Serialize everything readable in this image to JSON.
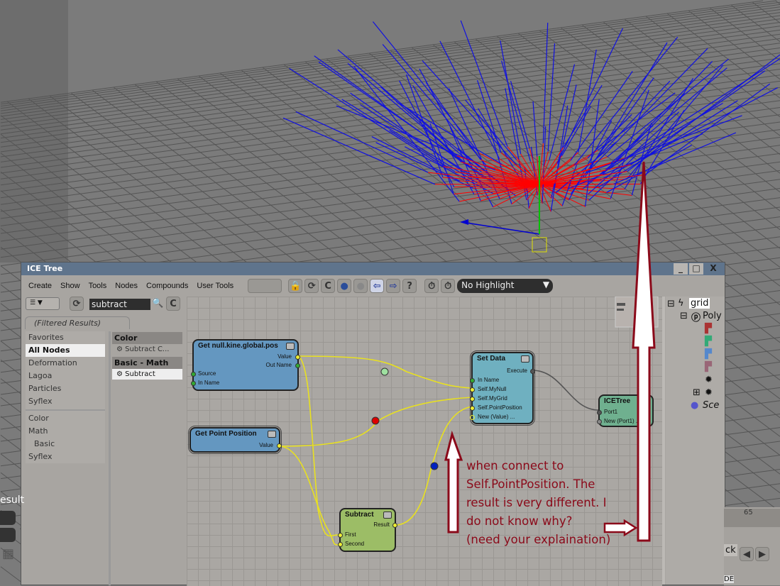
{
  "window": {
    "title": "ICE Tree",
    "minimize": "_",
    "maximize": "□",
    "close": "X"
  },
  "menu": [
    "Create",
    "Show",
    "Tools",
    "Nodes",
    "Compounds",
    "User Tools"
  ],
  "toolbar": {
    "highlight_select": "No Highlight",
    "help": "?"
  },
  "search": {
    "value": "subtract"
  },
  "filter_tab": "(Filtered Results)",
  "categories": [
    "Favorites",
    "All Nodes",
    "Deformation",
    "Lagoa",
    "Particles",
    "Syflex"
  ],
  "selected_category": "All Nodes",
  "subcategories": [
    "Color",
    "Math",
    "Basic",
    "Syflex"
  ],
  "results": [
    {
      "group": "Color",
      "items": [
        "Subtract C..."
      ]
    },
    {
      "group": "Basic - Math",
      "items": [
        "Subtract"
      ]
    }
  ],
  "nodes": {
    "get_null": {
      "title": "Get null.kine.global.pos",
      "outputs": [
        "Value",
        "Out Name"
      ],
      "inputs": [
        "Source",
        "In Name"
      ]
    },
    "get_point": {
      "title": "Get Point Position",
      "outputs": [
        "Value"
      ]
    },
    "subtract": {
      "title": "Subtract",
      "outputs": [
        "Result"
      ],
      "inputs": [
        "First",
        "Second"
      ]
    },
    "set_data": {
      "title": "Set Data",
      "outputs": [
        "Execute"
      ],
      "inputs": [
        "In Name",
        "Self.MyNull",
        "Self.MyGrid",
        "Self.PointPosition",
        "New (Value) ..."
      ]
    },
    "icetree": {
      "title": "ICETree",
      "inputs": [
        "Port1",
        "New (Port1) ..."
      ]
    }
  },
  "explorer": {
    "root": "grid",
    "child": "Poly",
    "scene": "Sce"
  },
  "viewport_partial": {
    "label": "esult",
    "frame": "65",
    "button": "ck",
    "status": "DE"
  },
  "annotation": "when connect to\nSelf.PointPosition. The\nresult is very different. I\ndo not know why?\n(need your explaination)",
  "colors": {
    "annotation": "#8b0a1a",
    "wire": "#e8e020",
    "getnode": "#6497c0",
    "setdata": "#6fb0c0",
    "subtract": "#9cbd66",
    "icetree": "#6fb08f"
  }
}
